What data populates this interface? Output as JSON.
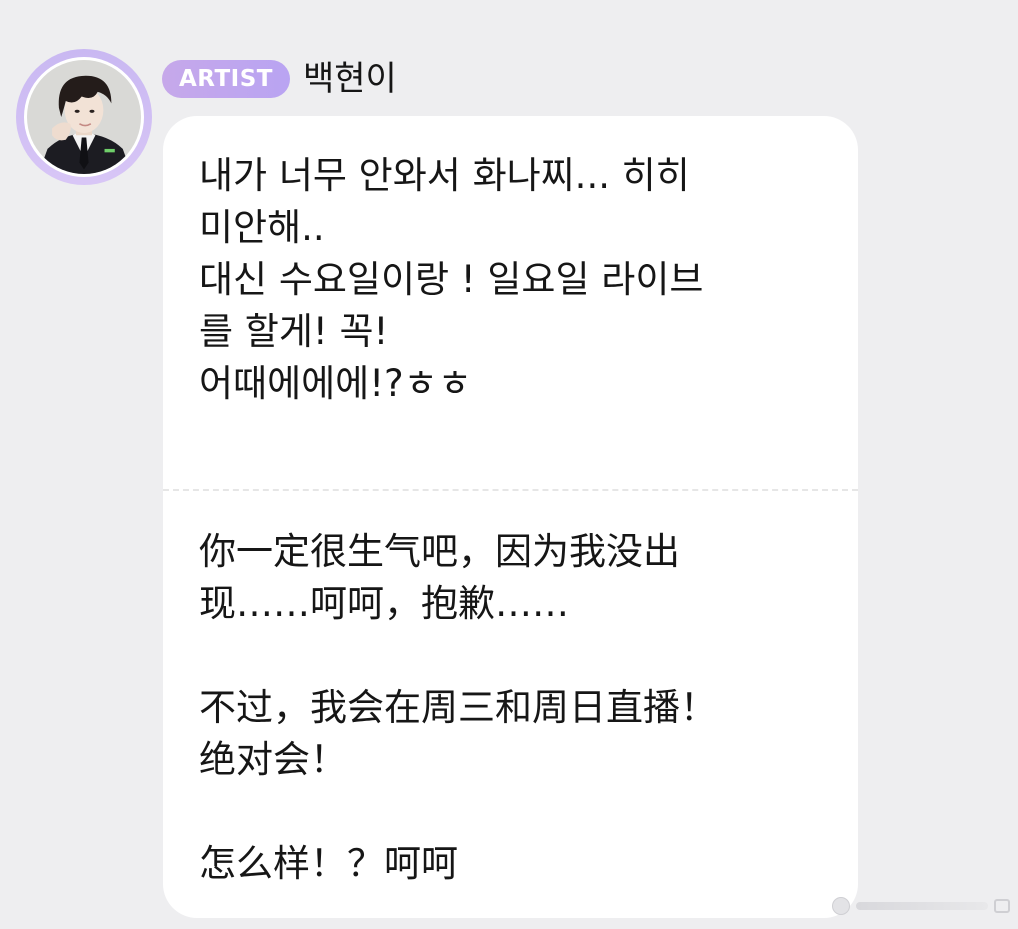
{
  "post": {
    "badge": "ARTIST",
    "author_name": "백현이",
    "message_korean": "내가 너무 안와서 화나찌... 히히\n미안해..\n대신 수요일이랑 ! 일요일 라이브\n를 할게! 꼭!\n어때에에에!?ㅎㅎ",
    "message_chinese": "你一定很生气吧，因为我没出\n现……呵呵，抱歉……\n\n不过，我会在周三和周日直播！\n绝对会！\n\n怎么样！？呵呵"
  },
  "icons": {
    "avatar": "artist-avatar-photo",
    "scrollbar": "horizontal-scrollbar"
  },
  "colors": {
    "background": "#eeeef0",
    "bubble": "#ffffff",
    "badge_gradient_start": "#c6a8ea",
    "badge_gradient_end": "#b9a4f2",
    "avatar_ring": "#c9b8f2",
    "text": "#161616"
  }
}
